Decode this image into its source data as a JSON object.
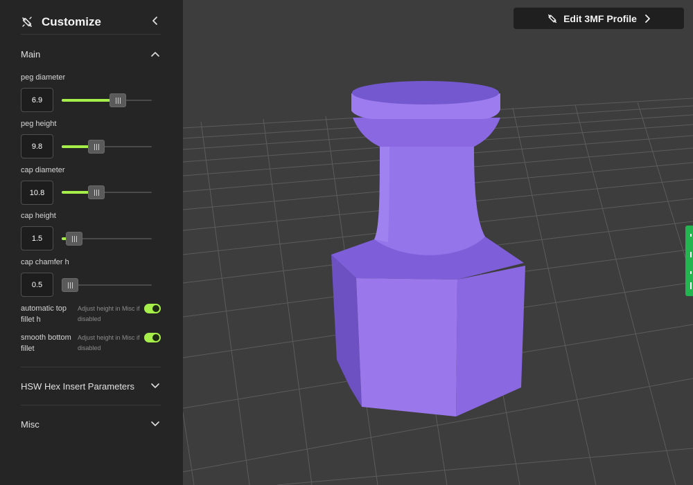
{
  "sidebar": {
    "title": "Customize",
    "title_icon": "wand-pencil-icon",
    "collapse_icon": "chevron-left-icon"
  },
  "sections": {
    "main": {
      "label": "Main",
      "expanded": true
    },
    "hex": {
      "label": "HSW Hex Insert Parameters",
      "expanded": false
    },
    "misc": {
      "label": "Misc",
      "expanded": false
    }
  },
  "params": {
    "peg_diameter": {
      "label": "peg diameter",
      "value": "6.9",
      "fraction": 0.65
    },
    "peg_height": {
      "label": "peg height",
      "value": "9.8",
      "fraction": 0.36
    },
    "cap_diameter": {
      "label": "cap diameter",
      "value": "10.8",
      "fraction": 0.36
    },
    "cap_height": {
      "label": "cap height",
      "value": "1.5",
      "fraction": 0.06
    },
    "cap_chamfer_h": {
      "label": "cap chamfer h",
      "value": "0.5",
      "fraction": 0.0
    }
  },
  "toggles": {
    "auto_top_fillet": {
      "label": "automatic top fillet h",
      "hint": "Adjust height in Misc if disabled",
      "on": true
    },
    "smooth_bottom_fillet": {
      "label": "smooth bottom fillet",
      "hint": "Adjust height in Misc if disabled",
      "on": true
    }
  },
  "toolbar": {
    "edit_label": "Edit 3MF Profile",
    "edit_icon": "wand-pencil-icon",
    "edit_chevron": "chevron-right-icon"
  },
  "colors": {
    "accent": "#a6ee4a",
    "model": "#9473ea",
    "side_tab": "#23b550",
    "sidebar_bg": "#252525",
    "viewport_bg": "#3d3d3d"
  }
}
